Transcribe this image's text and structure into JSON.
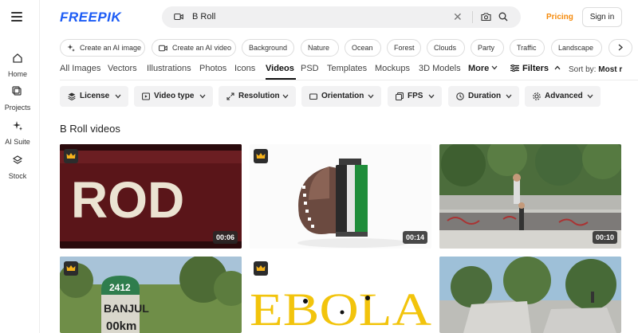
{
  "brand": {
    "logo_text": "FREEPIK",
    "accent": "#1d5cf5",
    "pricing_color": "#f58a0b"
  },
  "sidebar": {
    "items": [
      {
        "label": "Home",
        "icon": "home-icon"
      },
      {
        "label": "Projects",
        "icon": "projects-icon"
      },
      {
        "label": "AI Suite",
        "icon": "sparkle-icon"
      },
      {
        "label": "Stock",
        "icon": "stock-icon"
      }
    ]
  },
  "header": {
    "search_query": "B Roll",
    "pricing_label": "Pricing",
    "signin_label": "Sign in"
  },
  "chips": [
    {
      "label": "Create an AI image",
      "icon": "ai-image-icon"
    },
    {
      "label": "Create an AI video",
      "icon": "ai-video-icon"
    },
    {
      "label": "Background"
    },
    {
      "label": "Nature"
    },
    {
      "label": "Ocean"
    },
    {
      "label": "Forest"
    },
    {
      "label": "Clouds"
    },
    {
      "label": "Party"
    },
    {
      "label": "Traffic"
    },
    {
      "label": "Landscape"
    }
  ],
  "tabs": [
    {
      "label": "All Images"
    },
    {
      "label": "Vectors"
    },
    {
      "label": "Illustrations"
    },
    {
      "label": "Photos"
    },
    {
      "label": "Icons"
    },
    {
      "label": "Videos",
      "active": true
    },
    {
      "label": "PSD"
    },
    {
      "label": "Templates"
    },
    {
      "label": "Mockups"
    },
    {
      "label": "3D Models"
    },
    {
      "label": "More"
    }
  ],
  "filters_label": "Filters",
  "sort_by_label": "Sort by:",
  "sort_by_value": "Most r",
  "filter_buttons": [
    {
      "label": "License",
      "icon": "license-icon"
    },
    {
      "label": "Video type",
      "icon": "video-type-icon"
    },
    {
      "label": "Resolution",
      "icon": "resolution-icon"
    },
    {
      "label": "Orientation",
      "icon": "orientation-icon"
    },
    {
      "label": "FPS",
      "icon": "fps-icon"
    },
    {
      "label": "Duration",
      "icon": "duration-icon"
    },
    {
      "label": "Advanced",
      "icon": "advanced-icon"
    }
  ],
  "section_title": "B Roll videos",
  "videos": [
    {
      "duration": "00:06",
      "premium": true,
      "title_text": "ROD"
    },
    {
      "duration": "00:14",
      "premium": true
    },
    {
      "duration": "00:10",
      "premium": false
    },
    {
      "duration": "",
      "premium": true,
      "title_text": "2412 BANJUL 00km"
    },
    {
      "duration": "",
      "premium": true,
      "title_text": "EBOLA"
    },
    {
      "duration": "",
      "premium": false
    }
  ]
}
